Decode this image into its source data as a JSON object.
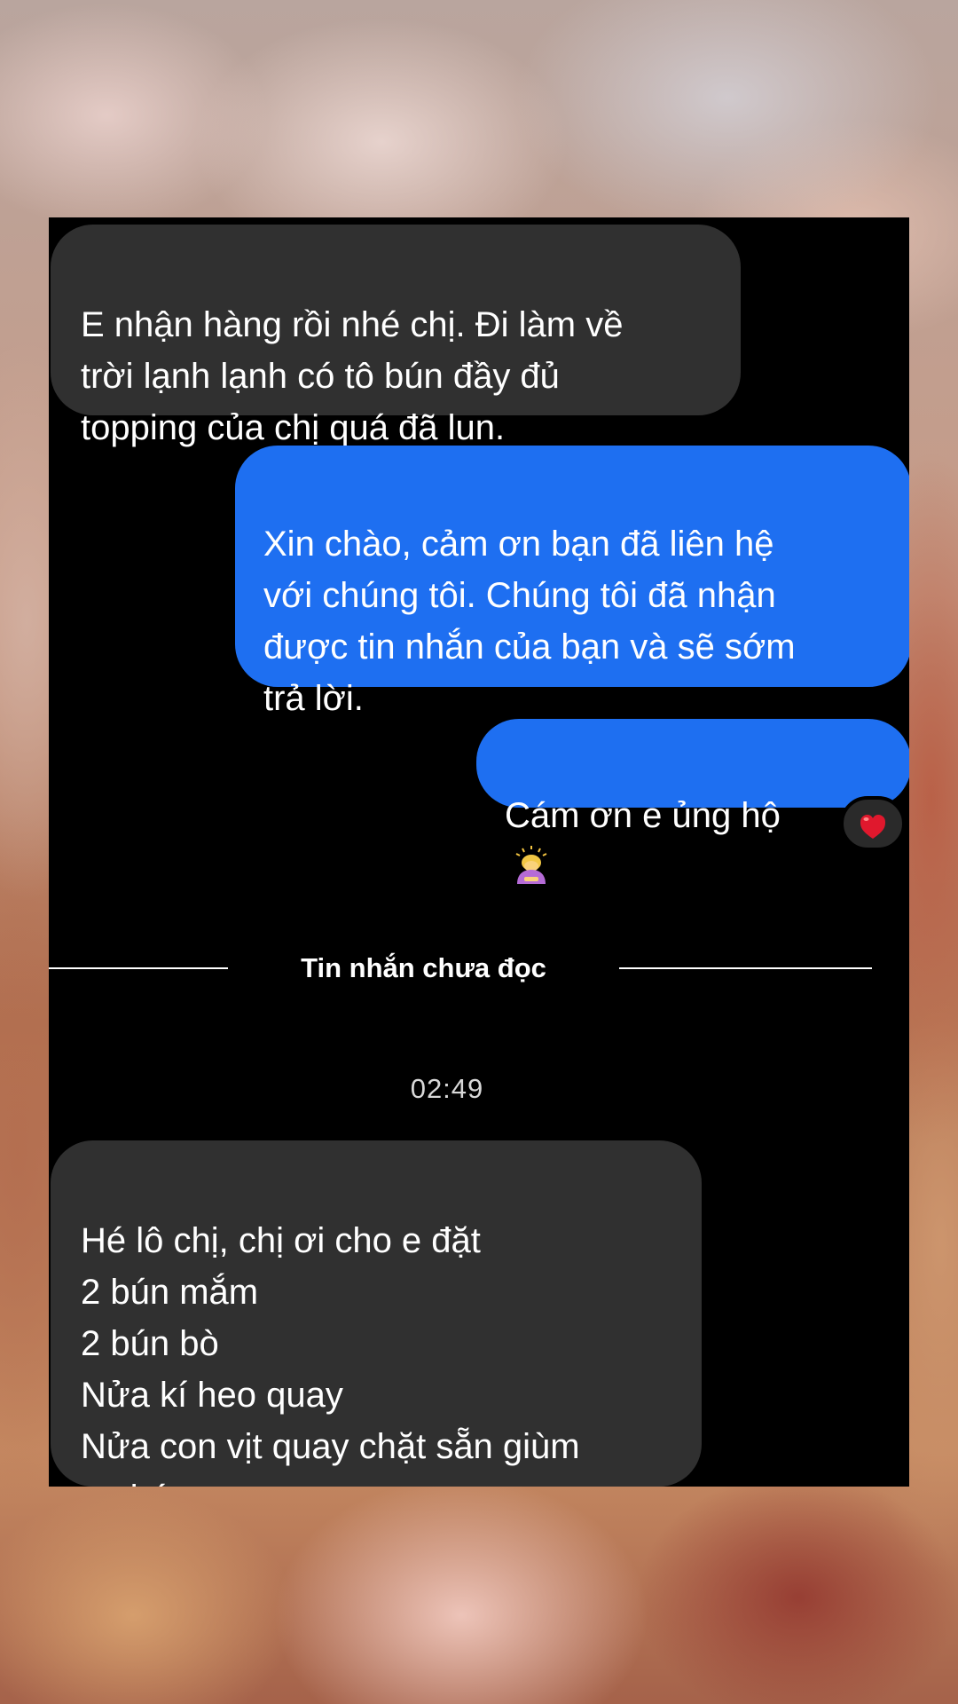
{
  "conversation": {
    "messages": [
      {
        "direction": "incoming",
        "text": "E nhận hàng rồi nhé chị. Đi làm về\ntrời lạnh lạnh có tô bún đầy đủ\ntopping của chị quá đã lun."
      },
      {
        "direction": "outgoing",
        "text": "Xin chào, cảm ơn bạn đã liên hệ\nvới chúng tôi. Chúng tôi đã nhận\nđược tin nhắn của bạn và sẽ sớm\ntrả lời."
      },
      {
        "direction": "outgoing",
        "text": "Cám ơn e ủng hộ",
        "emoji": "person-bowing-emoji",
        "reaction": "red-heart-emoji"
      },
      {
        "direction": "incoming",
        "text": "Hé lô chị, chị ơi cho e đặt\n2 bún mắm\n2 bún bò\nNửa kí heo quay\nNửa con vịt quay chặt sẵn giùm\ne nhé"
      }
    ],
    "unread_divider_label": "Tin nhắn chưa đọc",
    "timestamp": "02:49"
  },
  "colors": {
    "background": "#000000",
    "incoming_bubble": "#303030",
    "outgoing_bubble": "#1e6ff1",
    "text": "#ffffff",
    "heart": "#e0182d"
  }
}
